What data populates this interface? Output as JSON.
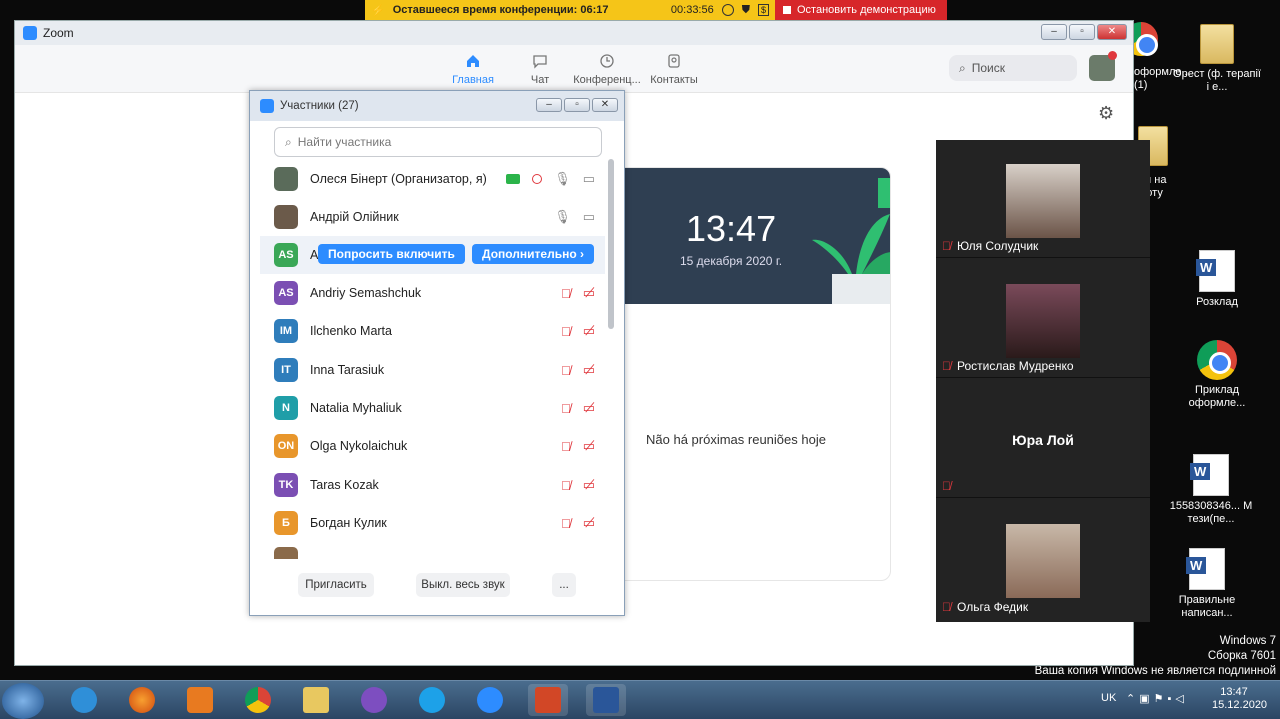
{
  "banner": {
    "remaining_label": "Оставшееся время конференции: 06:17",
    "elapsed": "00:33:56",
    "stop_label": "Остановить демонстрацию"
  },
  "desktop": {
    "icons": [
      {
        "label": "Орест (ф. терапії і е..."
      },
      {
        "label": "Розклад"
      },
      {
        "label": "Приклад оформле..."
      },
      {
        "label": "1558308346... М тези(пе..."
      },
      {
        "label": "Правильне написан..."
      }
    ],
    "partial_left": [
      "оформле...",
      "(1)",
      "зи на",
      "боту"
    ],
    "watermark": [
      "Windows 7",
      "Сборка 7601",
      "Ваша копия Windows не является подлинной"
    ]
  },
  "zoom": {
    "title": "Zoom",
    "nav": [
      {
        "label": "Главная"
      },
      {
        "label": "Чат"
      },
      {
        "label": "Конференц..."
      },
      {
        "label": "Контакты"
      }
    ],
    "search_placeholder": "Поиск",
    "time": "13:47",
    "date": "15 декабря 2020 г.",
    "no_meetings": "Não há próximas reuniões hoje"
  },
  "participants": {
    "title": "Участники (27)",
    "find_placeholder": "Найти участника",
    "ask_unmute": "Попросить включить",
    "more": "Дополнительно ›",
    "rows": [
      {
        "initials": "",
        "name": "Олеся Бінерт (Организатор, я)",
        "color": "#5a6b5a"
      },
      {
        "initials": "",
        "name": "Андрій Олійник",
        "color": "#6b5a4a"
      },
      {
        "initials": "AS",
        "name": "А",
        "color": "#3aa757"
      },
      {
        "initials": "AS",
        "name": "Andriy Semashchuk",
        "color": "#7b4fb3"
      },
      {
        "initials": "IM",
        "name": "Ilchenko Marta",
        "color": "#2f7dbb"
      },
      {
        "initials": "IT",
        "name": "Inna Tarasiuk",
        "color": "#2f7dbb"
      },
      {
        "initials": "N",
        "name": "Natalia Myhaliuk",
        "color": "#1f9ea8"
      },
      {
        "initials": "ON",
        "name": "Olga Nykolaichuk",
        "color": "#e8962b"
      },
      {
        "initials": "TK",
        "name": "Taras Kozak",
        "color": "#7b4fb3"
      },
      {
        "initials": "Б",
        "name": "Богдан Кулик",
        "color": "#e8962b"
      }
    ],
    "invite": "Пригласить",
    "mute_all": "Выкл. весь звук",
    "more_dots": "..."
  },
  "videos": [
    {
      "name": "Юля Солудчик"
    },
    {
      "name": "Ростислав Мудренко"
    },
    {
      "name": "Юра Лой"
    },
    {
      "name": "Ольга Федик"
    }
  ],
  "taskbar": {
    "lang": "UK",
    "time": "13:47",
    "date": "15.12.2020"
  }
}
